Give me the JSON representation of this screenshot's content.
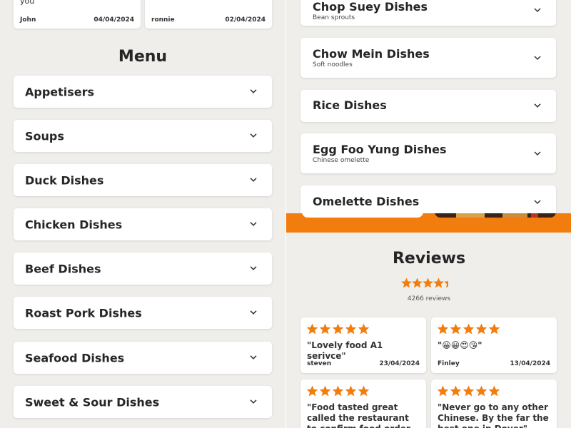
{
  "colors": {
    "accent": "#f37c0e",
    "star": "#f37c0e",
    "card": "#ffffff",
    "background": "#efeeeb"
  },
  "top_reviews": [
    {
      "text_fragment": "you",
      "name": "John",
      "date": "04/04/2024"
    },
    {
      "text_fragment": "",
      "name": "ronnie",
      "date": "02/04/2024"
    }
  ],
  "menu": {
    "title": "Menu",
    "categories": [
      {
        "label": "Appetisers"
      },
      {
        "label": "Soups"
      },
      {
        "label": "Duck Dishes"
      },
      {
        "label": "Chicken Dishes"
      },
      {
        "label": "Beef Dishes"
      },
      {
        "label": "Roast Pork Dishes"
      },
      {
        "label": "Seafood Dishes"
      },
      {
        "label": "Sweet & Sour Dishes"
      }
    ],
    "categories_right": [
      {
        "label": "Chop Suey Dishes",
        "subtitle": "Bean sprouts"
      },
      {
        "label": "Chow Mein Dishes",
        "subtitle": "Soft noodles"
      },
      {
        "label": "Rice Dishes",
        "subtitle": ""
      },
      {
        "label": "Egg Foo Yung Dishes",
        "subtitle": "Chinese omelette"
      },
      {
        "label": "Omelette Dishes",
        "subtitle": ""
      }
    ]
  },
  "reviews": {
    "title": "Reviews",
    "rating": 4.5,
    "count_text": "4266 reviews",
    "items": [
      {
        "stars": 5,
        "text": "\"Lovely food A1 serivce\"",
        "name": "steven",
        "date": "23/04/2024"
      },
      {
        "stars": 5,
        "text": "\"😀😀😍😘\"",
        "name": "Finley",
        "date": "13/04/2024"
      },
      {
        "stars": 5,
        "text": "\"Food tasted great called the restaurant to confirm food order, staff really",
        "name": "",
        "date": ""
      },
      {
        "stars": 5,
        "text": "\"Never go to any other Chinese. By the far the best one in Dover\"",
        "name": "",
        "date": ""
      }
    ]
  }
}
